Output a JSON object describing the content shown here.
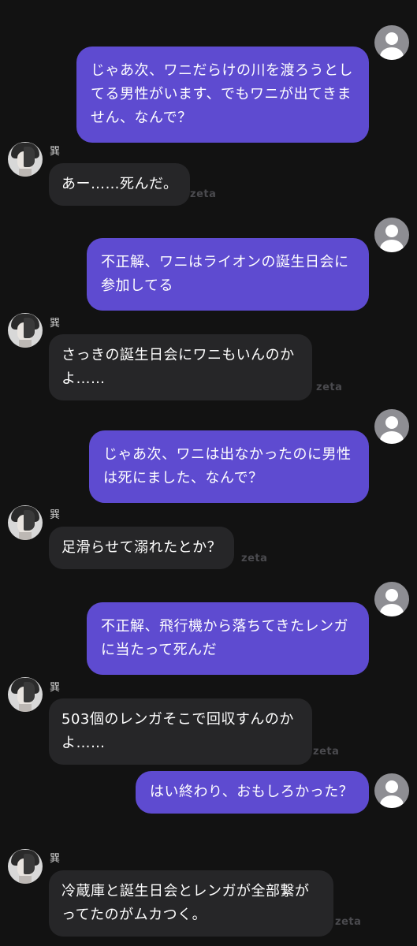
{
  "messages": [
    {
      "type": "user",
      "text": "じゃあ次、ワニだらけの川を渡ろうとしてる男性がいます、でもワニが出てきません、なんで？"
    },
    {
      "type": "bot",
      "name": "巽",
      "text": "あー……死んだ。",
      "watermark": "zeta"
    },
    {
      "type": "user",
      "text": "不正解、ワニはライオンの誕生日会に参加してる"
    },
    {
      "type": "bot",
      "name": "巽",
      "text": "さっきの誕生日会にワニもいんのかよ……",
      "watermark": "zeta"
    },
    {
      "type": "user",
      "text": "じゃあ次、ワニは出なかったのに男性は死にました、なんで？"
    },
    {
      "type": "bot",
      "name": "巽",
      "text": "足滑らせて溺れたとか？",
      "watermark": "zeta"
    },
    {
      "type": "user",
      "text": "不正解、飛行機から落ちてきたレンガに当たって死んだ"
    },
    {
      "type": "bot",
      "name": "巽",
      "text": "503個のレンガそこで回収すんのかよ……",
      "watermark": "zeta"
    },
    {
      "type": "user",
      "text": "はい終わり、おもしろかった？"
    },
    {
      "type": "bot",
      "name": "巽",
      "text": "冷蔵庫と誕生日会とレンガが全部繋がってたのがムカつく。",
      "watermark": "zeta"
    }
  ],
  "colors": {
    "background": "#121212",
    "user_bubble": "#5e4bd0",
    "bot_bubble": "#262628",
    "watermark": "#4a4a4e"
  },
  "icons": {
    "user_avatar": "default-user-silhouette-icon",
    "bot_avatar": "character-portrait"
  }
}
